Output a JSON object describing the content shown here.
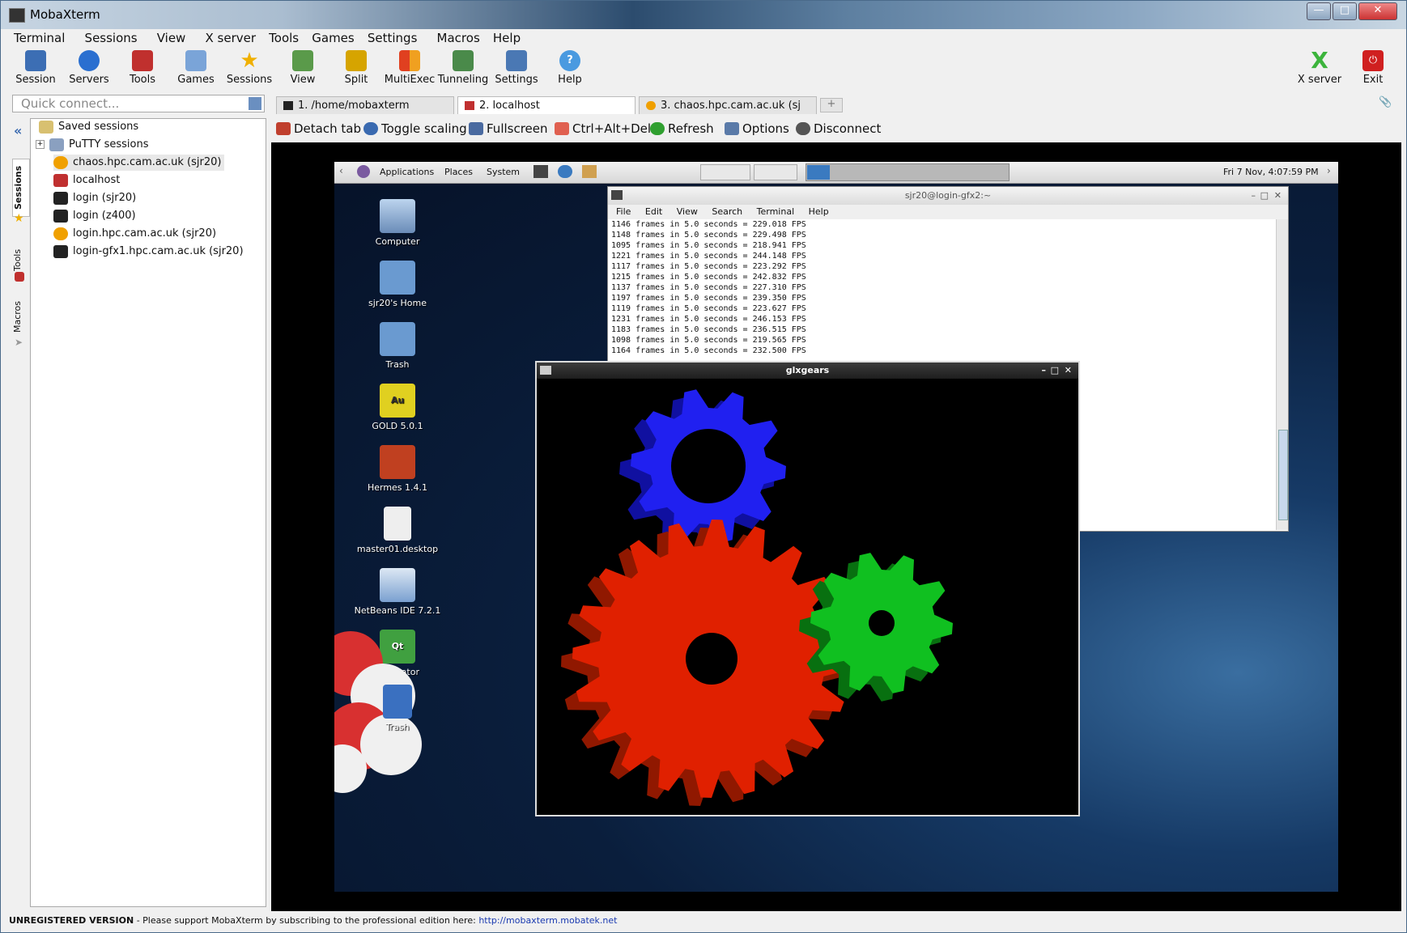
{
  "app": {
    "title": "MobaXterm"
  },
  "menu": [
    "Terminal",
    "Sessions",
    "View",
    "X server",
    "Tools",
    "Games",
    "Settings",
    "Macros",
    "Help"
  ],
  "toolbar": [
    {
      "label": "Session",
      "icon": "session-icon",
      "color": "#3c6eb4"
    },
    {
      "label": "Servers",
      "icon": "globe-icon",
      "color": "#2a6fd0"
    },
    {
      "label": "Tools",
      "icon": "tools-icon",
      "color": "#c0302e"
    },
    {
      "label": "Games",
      "icon": "games-icon",
      "color": "#7aa4d8"
    },
    {
      "label": "Sessions",
      "icon": "star-icon",
      "color": "#f0b000"
    },
    {
      "label": "View",
      "icon": "monitor-icon",
      "color": "#5a9a4a"
    },
    {
      "label": "Split",
      "icon": "split-icon",
      "color": "#d6a400"
    },
    {
      "label": "MultiExec",
      "icon": "multiexec-icon",
      "color": "#e04020"
    },
    {
      "label": "Tunneling",
      "icon": "tunneling-icon",
      "color": "#4a8a4a"
    },
    {
      "label": "Settings",
      "icon": "settings-icon",
      "color": "#4a78b4"
    },
    {
      "label": "Help",
      "icon": "help-icon",
      "color": "#4a9ae0"
    }
  ],
  "toolbar_right": [
    {
      "label": "X server",
      "icon": "x-server-icon",
      "color": "#3cb43c"
    },
    {
      "label": "Exit",
      "icon": "exit-icon",
      "color": "#d02020"
    }
  ],
  "quick_connect": {
    "placeholder": "Quick connect..."
  },
  "side_tabs": [
    "Sessions",
    "Tools",
    "Macros"
  ],
  "tree": {
    "root": "Saved sessions",
    "folder": "PuTTY sessions",
    "items": [
      "chaos.hpc.cam.ac.uk (sjr20)",
      "localhost",
      "login (sjr20)",
      "login (z400)",
      "login.hpc.cam.ac.uk (sjr20)",
      "login-gfx1.hpc.cam.ac.uk (sjr20)"
    ]
  },
  "tabs": [
    {
      "label": "1. /home/mobaxterm",
      "active": false
    },
    {
      "label": "2. localhost",
      "active": true
    },
    {
      "label": "3. chaos.hpc.cam.ac.uk (sj",
      "active": false
    }
  ],
  "vnc_toolbar": [
    "Detach tab",
    "Toggle scaling",
    "Fullscreen",
    "Ctrl+Alt+Del",
    "Refresh",
    "Options",
    "Disconnect"
  ],
  "remote": {
    "panel_menus": [
      "Applications",
      "Places",
      "System"
    ],
    "clock": "Fri 7 Nov, 4:07:59 PM",
    "desktop_icons": [
      "Computer",
      "sjr20's Home",
      "Trash",
      "GOLD 5.0.1",
      "Hermes 1.4.1",
      "master01.desktop",
      "NetBeans IDE 7.2.1",
      "QtCreator",
      "Trash"
    ],
    "terminal": {
      "title": "sjr20@login-gfx2:~",
      "menus": [
        "File",
        "Edit",
        "View",
        "Search",
        "Terminal",
        "Help"
      ],
      "lines": [
        "1146 frames in 5.0 seconds = 229.018 FPS",
        "1148 frames in 5.0 seconds = 229.498 FPS",
        "1095 frames in 5.0 seconds = 218.941 FPS",
        "1221 frames in 5.0 seconds = 244.148 FPS",
        "1117 frames in 5.0 seconds = 223.292 FPS",
        "1215 frames in 5.0 seconds = 242.832 FPS",
        "1137 frames in 5.0 seconds = 227.310 FPS",
        "1197 frames in 5.0 seconds = 239.350 FPS",
        "1119 frames in 5.0 seconds = 223.627 FPS",
        "1231 frames in 5.0 seconds = 246.153 FPS",
        "1183 frames in 5.0 seconds = 236.515 FPS",
        "1098 frames in 5.0 seconds = 219.565 FPS",
        "1164 frames in 5.0 seconds = 232.500 FPS"
      ]
    },
    "glxgears": {
      "title": "glxgears",
      "colors": {
        "red": "#e02000",
        "green": "#10c020",
        "blue": "#2020f0"
      }
    }
  },
  "status": {
    "bold": "UNREGISTERED VERSION",
    "text": " -  Please support MobaXterm by subscribing to the professional edition here: ",
    "link": "http://mobaxterm.mobatek.net"
  }
}
